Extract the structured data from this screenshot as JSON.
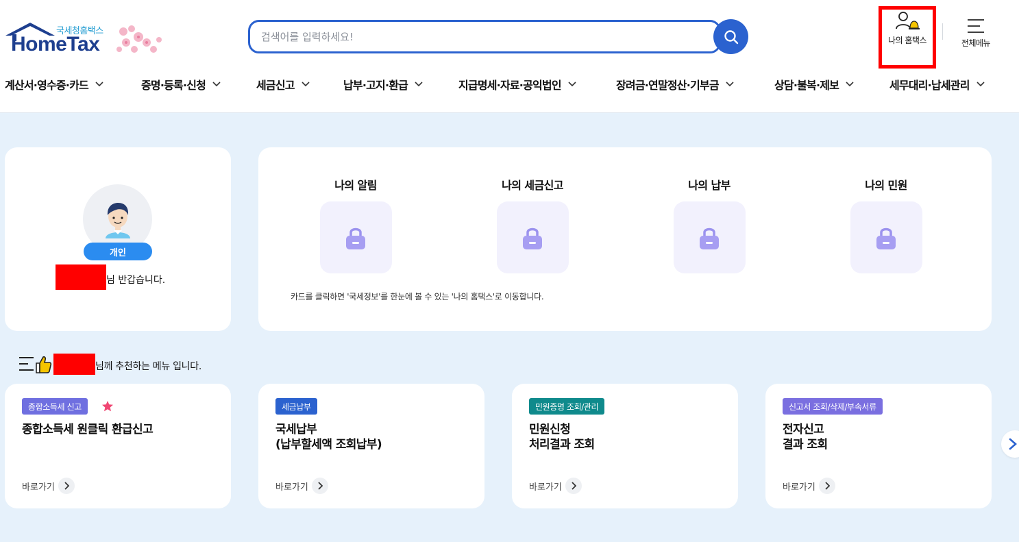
{
  "header": {
    "logo": {
      "sub_text": "국세청홈택스",
      "main_text": "HomeTax"
    },
    "search": {
      "placeholder": "검색어를 입력하세요!",
      "value": ""
    },
    "my_hometax_label": "나의 홈택스",
    "all_menu_label": "전체메뉴",
    "colors": {
      "brand_blue": "#2b62cf",
      "highlight_red": "#ff0000"
    }
  },
  "gnb": [
    {
      "label": "계산서·영수증·카드"
    },
    {
      "label": "증명·등록·신청"
    },
    {
      "label": "세금신고"
    },
    {
      "label": "납부·고지·환급"
    },
    {
      "label": "지급명세·자료·공익법인"
    },
    {
      "label": "장려금·연말정산·기부금"
    },
    {
      "label": "상담·불복·제보"
    },
    {
      "label": "세무대리·납세관리"
    }
  ],
  "profile": {
    "badge": "개인",
    "greeting_suffix": "님 반갑습니다."
  },
  "my_menu": {
    "items": [
      {
        "label": "나의 알림",
        "icon": "lock-icon"
      },
      {
        "label": "나의 세금신고",
        "icon": "lock-icon"
      },
      {
        "label": "나의 납부",
        "icon": "lock-icon"
      },
      {
        "label": "나의 민원",
        "icon": "lock-icon"
      }
    ],
    "notice": "카드를 클릭하면 '국세정보'를 한눈에 볼 수 있는 '나의 홈택스'로 이동합니다."
  },
  "recommend": {
    "suffix": "님께 추천하는 메뉴 입니다.",
    "cards": [
      {
        "tag": "종합소득세 신고",
        "tag_color": "#6f6fe0",
        "title": "종합소득세 원클릭 환급신고",
        "goto": "바로가기",
        "starred": true
      },
      {
        "tag": "세금납부",
        "tag_color": "#2b62cf",
        "title": "국세납부\n(납부할세액 조회납부)",
        "goto": "바로가기",
        "starred": false
      },
      {
        "tag": "민원증명 조회/관리",
        "tag_color": "#0f8a8c",
        "title": "민원신청\n처리결과 조회",
        "goto": "바로가기",
        "starred": false
      },
      {
        "tag": "신고서 조회/삭제/부속서류",
        "tag_color": "#7a6fe0",
        "title": "전자신고\n결과 조회",
        "goto": "바로가기",
        "starred": false
      }
    ]
  }
}
